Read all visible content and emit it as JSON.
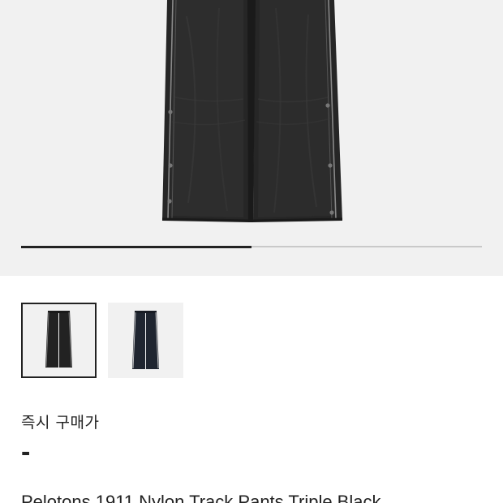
{
  "gallery": {
    "progress": 0.5,
    "thumbnails": [
      {
        "name": "thumbnail-black",
        "selected": true,
        "color": "#1e1e1e"
      },
      {
        "name": "thumbnail-navy",
        "selected": false,
        "color": "#1f2530"
      }
    ]
  },
  "price": {
    "label": "즉시 구매가",
    "value": "-"
  },
  "product": {
    "title": "Pelotons 1911 Nylon Track Pants Triple Black"
  },
  "colors": {
    "hero_background": "#f1f1f1",
    "pants_main": "#222222",
    "pants_shade": "#2b2b2b",
    "accent_text": "#222222"
  }
}
